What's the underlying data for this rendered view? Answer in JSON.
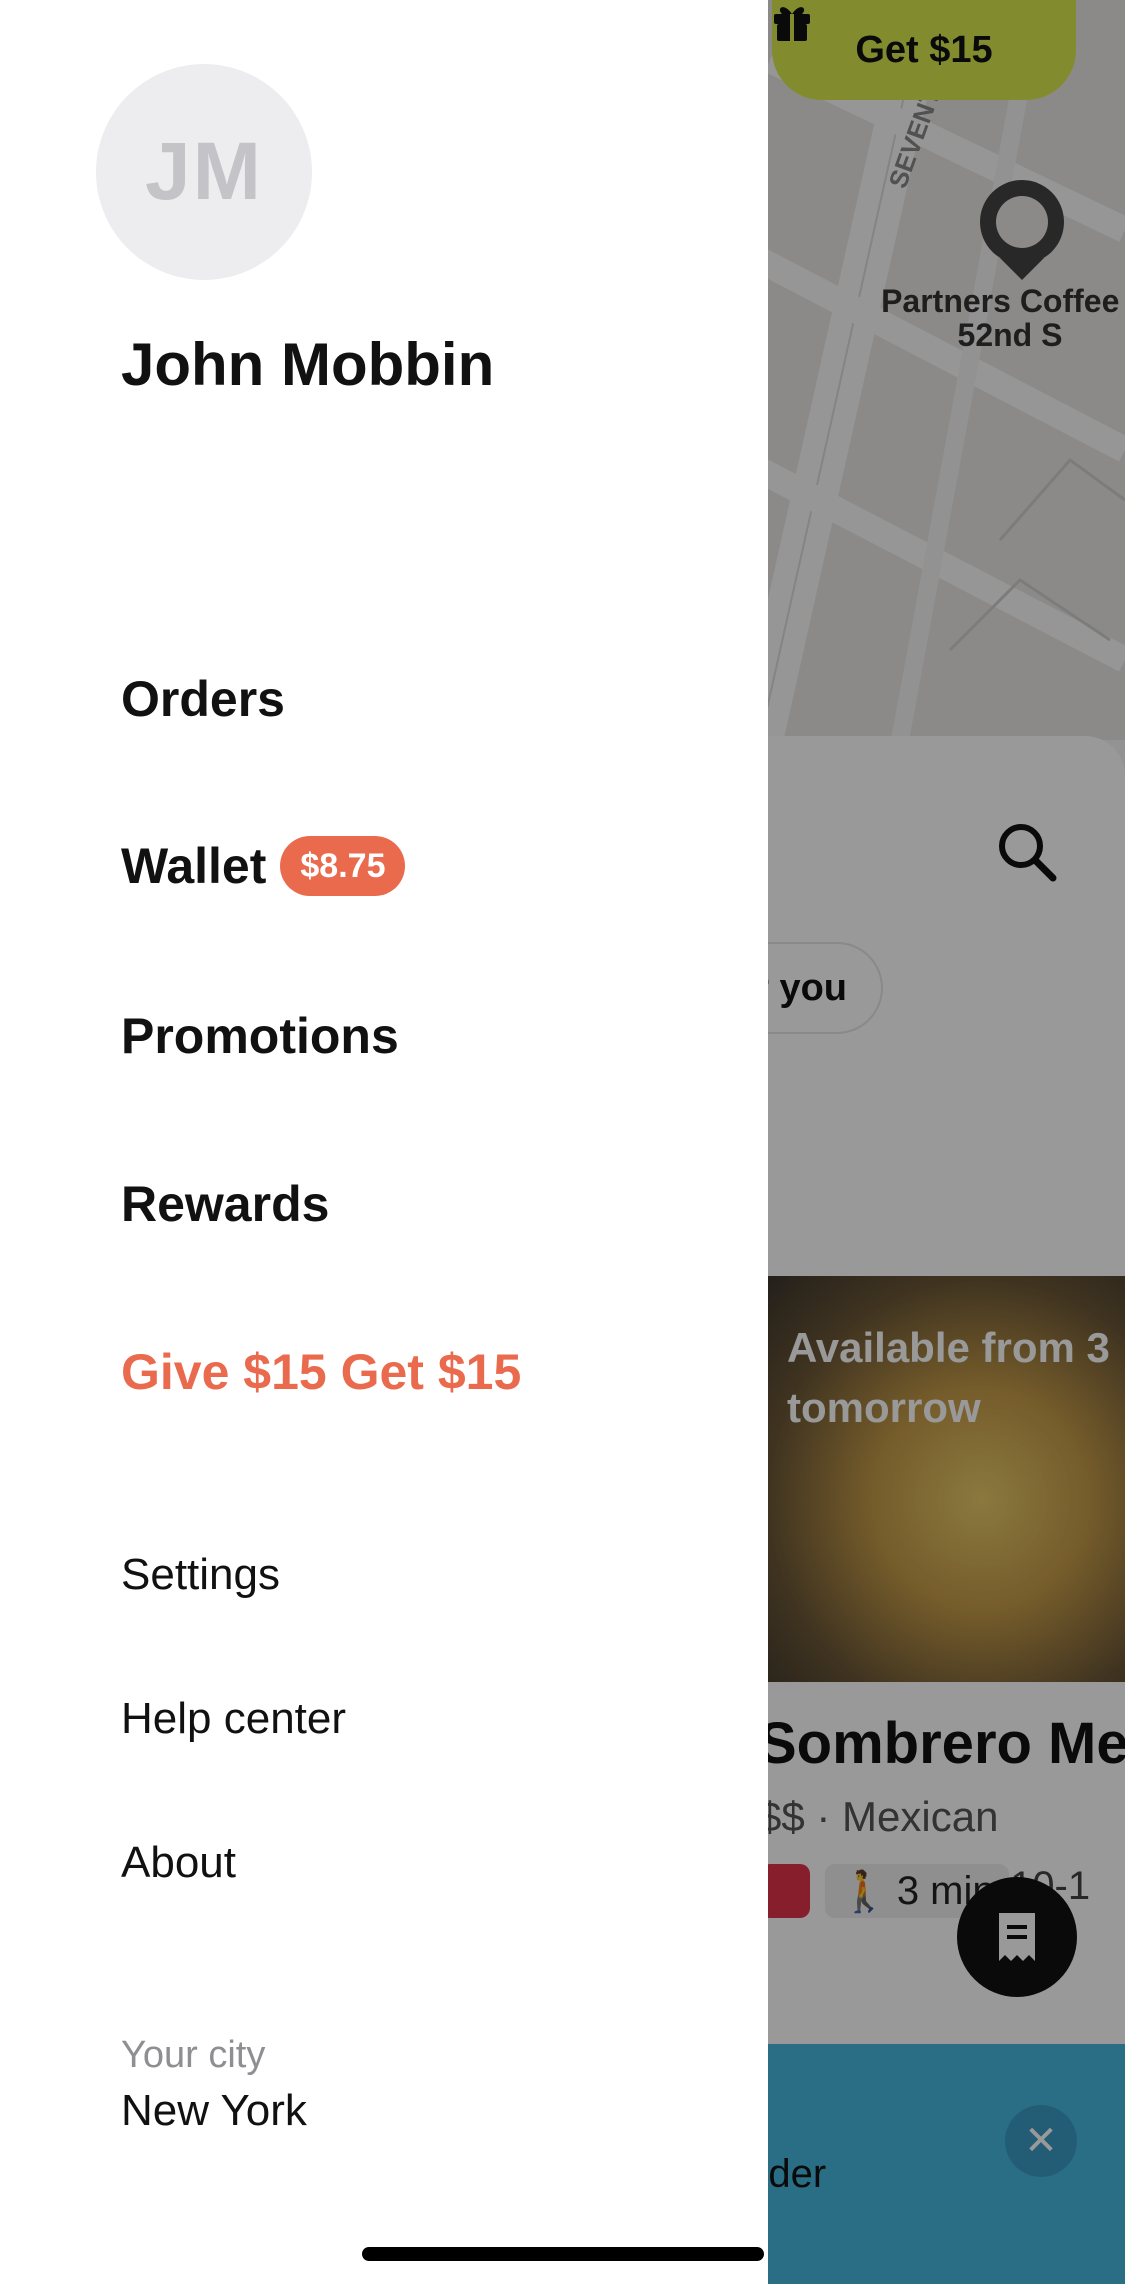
{
  "user": {
    "initials": "JM",
    "name": "John Mobbin"
  },
  "menu": {
    "orders": "Orders",
    "wallet": "Wallet",
    "wallet_balance": "$8.75",
    "promotions": "Promotions",
    "rewards": "Rewards",
    "referral": "Give $15 Get $15",
    "settings": "Settings",
    "help": "Help center",
    "about": "About"
  },
  "city": {
    "label": "Your city",
    "value": "New York"
  },
  "background": {
    "gift_button": "Get $15",
    "map_pin_label": "Partners Coffee - 52nd S",
    "street_label": "SEVENTH AV",
    "chip_label": "r you",
    "promo_text": "Available from 3 tomorrow",
    "restaurant_name": "Sombrero Mex",
    "restaurant_meta": "$$ · Mexican",
    "walk_time": "3 min",
    "time_range": "10-1",
    "banner_text": "rder"
  },
  "colors": {
    "accent": "#EA6A4E",
    "gift_pill": "#D9E94E",
    "banner": "#46B7E0"
  },
  "icons": [
    "gift-icon",
    "map-pin-icon",
    "search-icon",
    "walking-icon",
    "tag-icon",
    "receipt-icon",
    "close-icon"
  ]
}
